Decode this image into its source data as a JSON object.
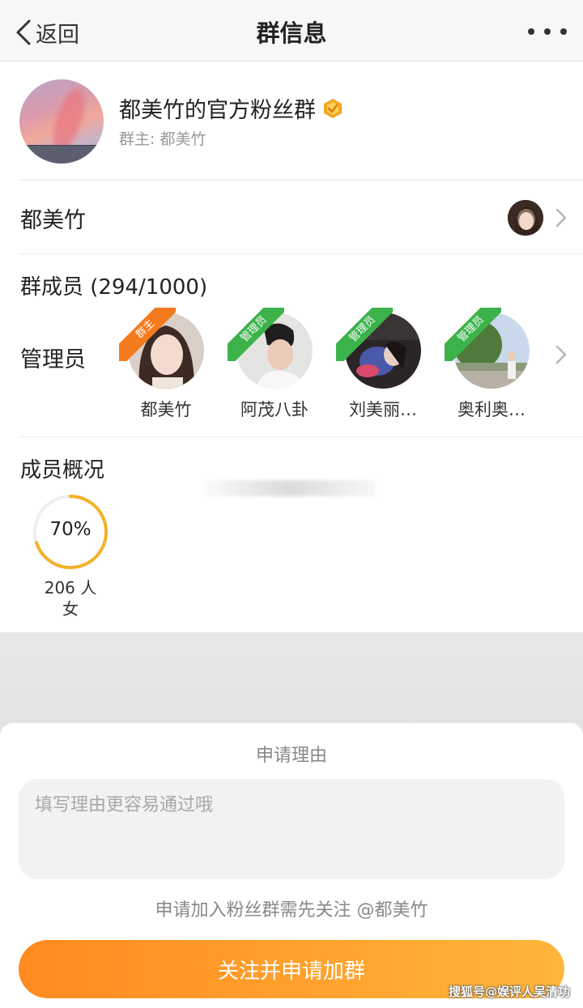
{
  "nav": {
    "back_label": "返回",
    "title": "群信息"
  },
  "group": {
    "name": "都美竹的官方粉丝群",
    "owner_prefix": "群主: ",
    "owner_name": "都美竹"
  },
  "owner_row": {
    "label": "都美竹"
  },
  "members": {
    "title": "群成员 (294/1000)",
    "admin_label": "管理员",
    "admins": [
      {
        "name": "都美竹",
        "role": "群主"
      },
      {
        "name": "阿茂八卦",
        "role": "管理员"
      },
      {
        "name": "刘美丽…",
        "role": "管理员"
      },
      {
        "name": "奥利奥…",
        "role": "管理员"
      }
    ]
  },
  "overview": {
    "title": "成员概况",
    "percent_label": "70%",
    "percent": 0.7,
    "count": "206 人",
    "gender": "女",
    "ring_color": "#f5b12a"
  },
  "sheet": {
    "title": "申请理由",
    "reason_placeholder": "填写理由更容易通过哦",
    "hint": "申请加入粉丝群需先关注 @都美竹",
    "button_label": "关注并申请加群"
  },
  "watermark": "搜狐号@娱评人吴清功"
}
